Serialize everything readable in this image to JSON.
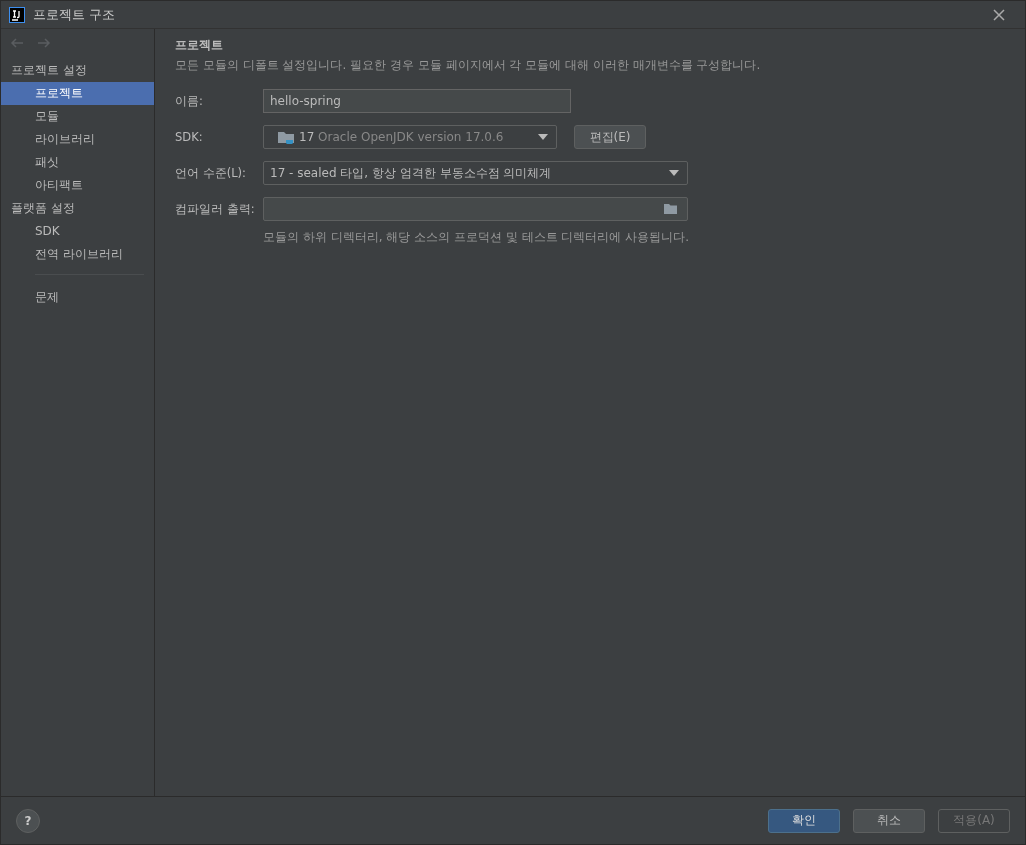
{
  "window": {
    "title": "프로젝트 구조"
  },
  "sidebar": {
    "groups": [
      {
        "label": "프로젝트 설정",
        "children": [
          {
            "label": "프로젝트",
            "selected": true
          },
          {
            "label": "모듈",
            "selected": false
          },
          {
            "label": "라이브러리",
            "selected": false
          },
          {
            "label": "패싯",
            "selected": false
          },
          {
            "label": "아티팩트",
            "selected": false
          }
        ]
      },
      {
        "label": "플랫폼 설정",
        "children": [
          {
            "label": "SDK",
            "selected": false
          },
          {
            "label": "전역 라이브러리",
            "selected": false
          }
        ]
      }
    ],
    "extra": [
      {
        "label": "문제",
        "selected": false
      }
    ]
  },
  "content": {
    "heading": "프로젝트",
    "description": "모든 모듈의 디폴트 설정입니다. 필요한 경우 모듈 페이지에서 각 모듈에 대해 이러한 매개변수를 구성합니다.",
    "name": {
      "label": "이름:",
      "value": "hello-spring"
    },
    "sdk": {
      "label": "SDK:",
      "version": "17",
      "detail": "Oracle OpenJDK version 17.0.6",
      "edit_button": "편집(E)"
    },
    "language_level": {
      "label": "언어 수준(L):",
      "value": "17 - sealed 타입, 항상 엄격한 부동소수점 의미체계"
    },
    "compiler_output": {
      "label": "컴파일러 출력:",
      "hint": "모듈의 하위 디렉터리, 해당 소스의 프로덕션 및 테스트 디렉터리에 사용됩니다."
    }
  },
  "footer": {
    "help": "?",
    "buttons": [
      {
        "label": "확인",
        "kind": "primary",
        "disabled": false
      },
      {
        "label": "취소",
        "kind": "normal",
        "disabled": false
      },
      {
        "label": "적용(A)",
        "kind": "normal",
        "disabled": true
      }
    ]
  }
}
